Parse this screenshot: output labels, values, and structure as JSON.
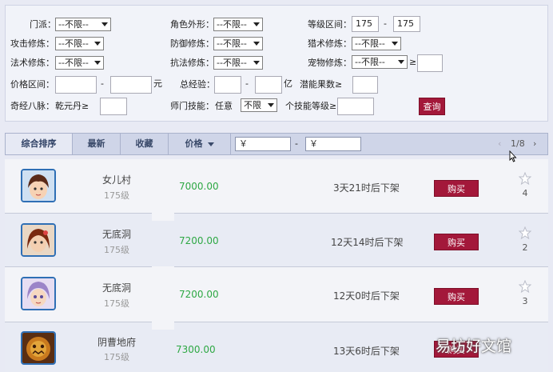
{
  "filters": {
    "school_label": "门派：",
    "school_value": "--不限--",
    "appearance_label": "角色外形：",
    "appearance_value": "--不限--",
    "level_label": "等级区间：",
    "level_min": "175",
    "level_sep": "-",
    "level_max": "175",
    "attack_label": "攻击修炼：",
    "attack_value": "--不限--",
    "defense_label": "防御修炼：",
    "defense_value": "--不限--",
    "hunt_label": "猎术修炼：",
    "hunt_value": "--不限--",
    "magic_label": "法术修炼：",
    "magic_value": "--不限--",
    "resist_label": "抗法修炼：",
    "resist_value": "--不限--",
    "pet_label": "宠物修炼：",
    "pet_value": "--不限--",
    "pet_ge": "≥",
    "price_label": "价格区间：",
    "price_sep": "-",
    "price_unit": "元",
    "exp_label": "总经验：",
    "exp_sep": "-",
    "exp_unit": "亿",
    "potential_label": "潜能果数≥",
    "meridian_label": "奇经八脉：",
    "meridian_item": "乾元丹≥",
    "skill_label": "师门技能：",
    "skill_any": "任意",
    "skill_value": "不限",
    "skill_level_label": "个技能等级≥",
    "query_button": "查询"
  },
  "toolbar": {
    "tabs": [
      "综合排序",
      "最新",
      "收藏",
      "价格"
    ],
    "price_min_placeholder": "￥",
    "price_sep": "-",
    "price_max_placeholder": "￥",
    "pager": "1/8",
    "prev": "‹",
    "next": "›"
  },
  "listings": [
    {
      "school": "女儿村",
      "level": "175级",
      "price": "7000.00",
      "time": "3天21时后下架",
      "buy": "购买",
      "favorites": "4"
    },
    {
      "school": "无底洞",
      "level": "175级",
      "price": "7200.00",
      "time": "12天14时后下架",
      "buy": "购买",
      "favorites": "2"
    },
    {
      "school": "无底洞",
      "level": "175级",
      "price": "7200.00",
      "time": "12天0时后下架",
      "buy": "购买",
      "favorites": "3"
    },
    {
      "school": "阴曹地府",
      "level": "175级",
      "price": "7300.00",
      "time": "13天6时后下架",
      "buy": "购买",
      "favorites": ""
    }
  ],
  "watermark": "易坊好文馆",
  "colors": {
    "accent": "#a3183a",
    "price": "#2ea844",
    "tab_bar": "#cfd5e8",
    "avatar_border": "#2f6fb5"
  }
}
